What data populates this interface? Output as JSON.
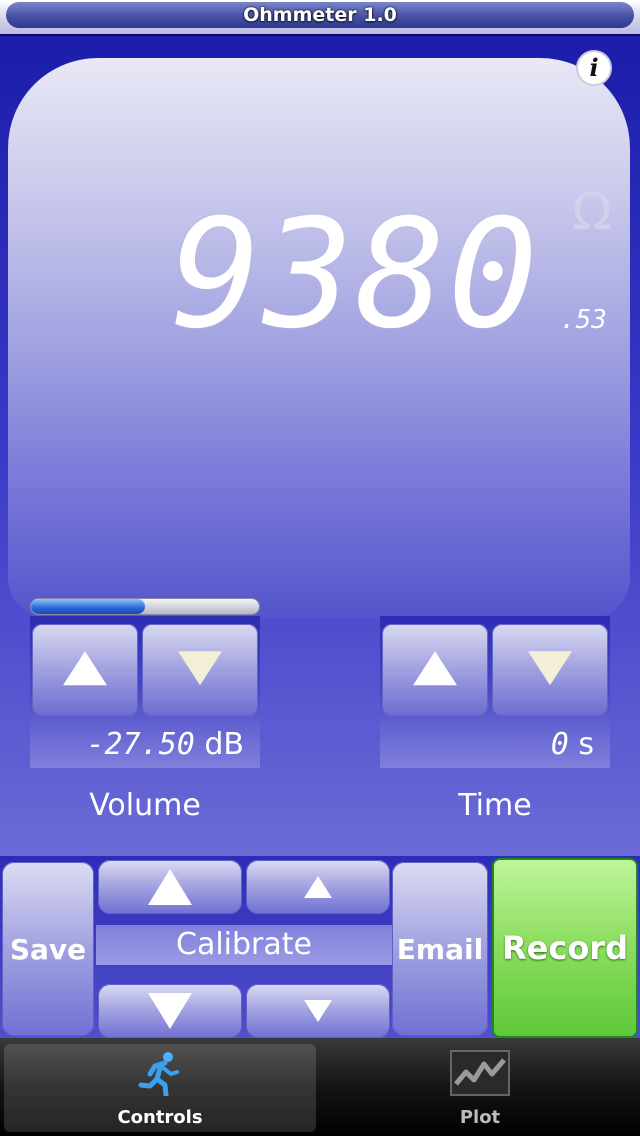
{
  "app": {
    "title": "Ohmmeter 1.0"
  },
  "display": {
    "reading_main": "9380",
    "reading_fraction": ".53",
    "unit_symbol": "Ω",
    "info_label": "i"
  },
  "volume": {
    "level_fraction": 0.5,
    "readout_value": "-27.50",
    "readout_unit": "dB",
    "caption": "Volume"
  },
  "time": {
    "readout_value": "0",
    "readout_unit": "s",
    "caption": "Time"
  },
  "bottom": {
    "save_label": "Save",
    "calibrate_label": "Calibrate",
    "email_label": "Email",
    "record_label": "Record"
  },
  "tabs": [
    {
      "label": "Controls",
      "icon": "running-man-icon",
      "active": true
    },
    {
      "label": "Plot",
      "icon": "plot-graph-icon",
      "active": false
    }
  ],
  "colors": {
    "background": "#3a3ac8",
    "record_green": "#8fdf62",
    "volume_fill": "#2b66d8"
  }
}
